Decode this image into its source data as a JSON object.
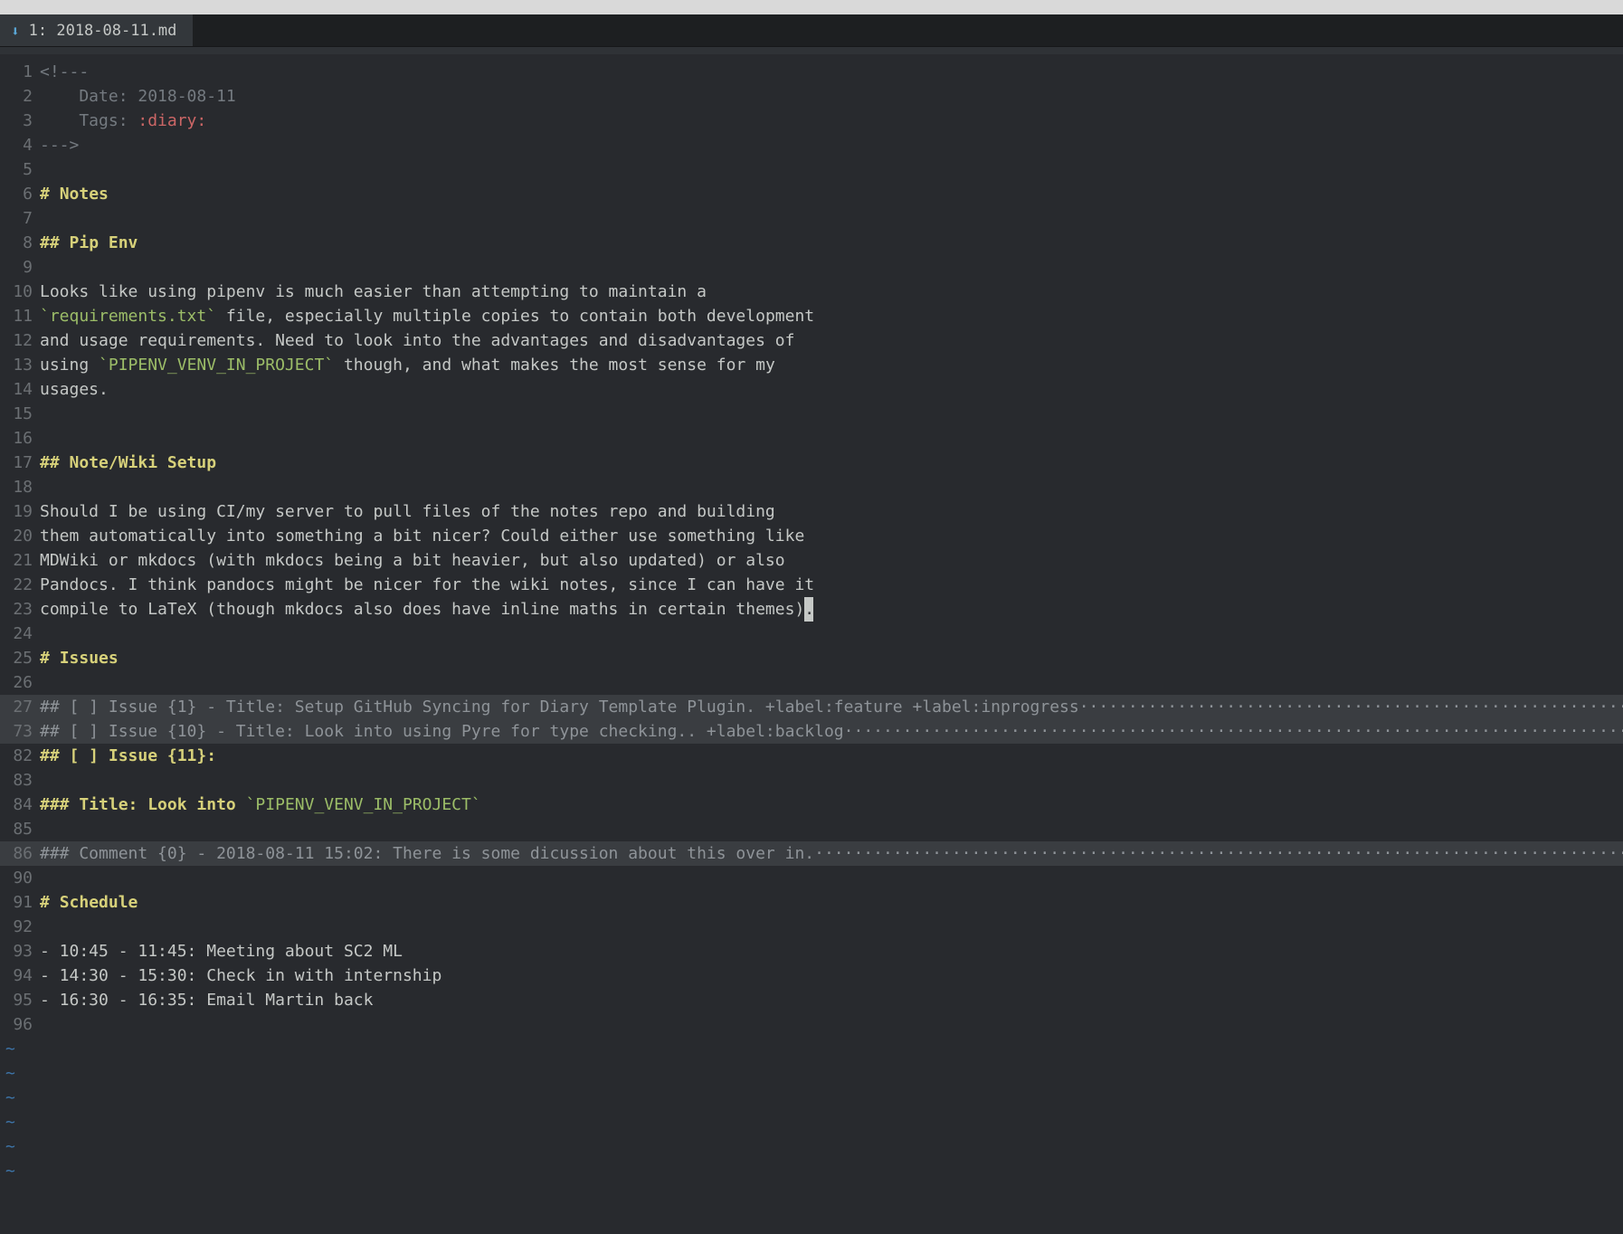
{
  "tab": {
    "icon_glyph": "⬇",
    "label": "1: 2018-08-11.md"
  },
  "dots_long": "·················································································································",
  "lines": [
    {
      "num": "1",
      "segments": [
        {
          "cls": "comment",
          "text": "<!---"
        }
      ]
    },
    {
      "num": "2",
      "segments": [
        {
          "cls": "comment",
          "text": "    Date: 2018-08-11"
        }
      ]
    },
    {
      "num": "3",
      "segments": [
        {
          "cls": "comment",
          "text": "    Tags: "
        },
        {
          "cls": "red",
          "text": ":diary:"
        }
      ]
    },
    {
      "num": "4",
      "segments": [
        {
          "cls": "comment",
          "text": "--->"
        }
      ]
    },
    {
      "num": "5",
      "segments": []
    },
    {
      "num": "6",
      "segments": [
        {
          "cls": "yellow",
          "text": "# "
        },
        {
          "cls": "yellow",
          "text": "Notes"
        }
      ]
    },
    {
      "num": "7",
      "segments": []
    },
    {
      "num": "8",
      "segments": [
        {
          "cls": "yellow",
          "text": "## "
        },
        {
          "cls": "yellow",
          "text": "Pip Env"
        }
      ]
    },
    {
      "num": "9",
      "segments": []
    },
    {
      "num": "10",
      "segments": [
        {
          "cls": "plain",
          "text": "Looks like using pipenv is much easier than attempting to maintain a"
        }
      ]
    },
    {
      "num": "11",
      "segments": [
        {
          "cls": "green",
          "text": "`requirements.txt`"
        },
        {
          "cls": "plain",
          "text": " file, especially multiple copies to contain both development"
        }
      ]
    },
    {
      "num": "12",
      "segments": [
        {
          "cls": "plain",
          "text": "and usage requirements. Need to look into the advantages and disadvantages of"
        }
      ]
    },
    {
      "num": "13",
      "segments": [
        {
          "cls": "plain",
          "text": "using "
        },
        {
          "cls": "green",
          "text": "`PIPENV_VENV_IN_PROJECT`"
        },
        {
          "cls": "plain",
          "text": " though, and what makes the most sense for my"
        }
      ]
    },
    {
      "num": "14",
      "segments": [
        {
          "cls": "plain",
          "text": "usages."
        }
      ]
    },
    {
      "num": "15",
      "segments": []
    },
    {
      "num": "16",
      "segments": []
    },
    {
      "num": "17",
      "segments": [
        {
          "cls": "yellow",
          "text": "## "
        },
        {
          "cls": "yellow",
          "text": "Note/Wiki Setup"
        }
      ]
    },
    {
      "num": "18",
      "segments": []
    },
    {
      "num": "19",
      "segments": [
        {
          "cls": "plain",
          "text": "Should I be using CI/my server to pull files of the notes repo and building"
        }
      ]
    },
    {
      "num": "20",
      "segments": [
        {
          "cls": "plain",
          "text": "them automatically into something a bit nicer? Could either use something like"
        }
      ]
    },
    {
      "num": "21",
      "segments": [
        {
          "cls": "plain",
          "text": "MDWiki or mkdocs (with mkdocs being a bit heavier, but also updated) or also"
        }
      ]
    },
    {
      "num": "22",
      "segments": [
        {
          "cls": "plain",
          "text": "Pandocs. I think pandocs might be nicer for the wiki notes, since I can have it"
        }
      ]
    },
    {
      "num": "23",
      "segments": [
        {
          "cls": "plain",
          "text": "compile to LaTeX (though mkdocs also does have inline maths in certain themes)"
        },
        {
          "cls": "cursor",
          "text": "."
        }
      ]
    },
    {
      "num": "24",
      "segments": []
    },
    {
      "num": "25",
      "segments": [
        {
          "cls": "yellow",
          "text": "# "
        },
        {
          "cls": "yellow",
          "text": "Issues"
        }
      ]
    },
    {
      "num": "26",
      "segments": []
    },
    {
      "num": "27",
      "fold": true,
      "segments": [
        {
          "cls": "foldtext",
          "text": "## [ ] Issue {1} - Title: Setup GitHub Syncing for Diary Template Plugin. +label:feature +label:inprogress"
        },
        {
          "cls": "dots",
          "bind": "dots_long"
        }
      ]
    },
    {
      "num": "73",
      "fold": true,
      "segments": [
        {
          "cls": "foldtext",
          "text": "## [ ] Issue {10} - Title: Look into using Pyre for type checking.. +label:backlog"
        },
        {
          "cls": "dots",
          "bind": "dots_long"
        }
      ]
    },
    {
      "num": "82",
      "segments": [
        {
          "cls": "yellow",
          "text": "## [ ] Issue {11}:"
        }
      ]
    },
    {
      "num": "83",
      "segments": []
    },
    {
      "num": "84",
      "segments": [
        {
          "cls": "yellow",
          "text": "### "
        },
        {
          "cls": "yellow",
          "text": "Title: Look into "
        },
        {
          "cls": "green",
          "text": "`PIPENV_VENV_IN_PROJECT`"
        }
      ]
    },
    {
      "num": "85",
      "segments": []
    },
    {
      "num": "86",
      "fold": true,
      "segments": [
        {
          "cls": "foldtext",
          "text": "### Comment {0} - 2018-08-11 15:02: There is some dicussion about this over in."
        },
        {
          "cls": "dots",
          "bind": "dots_long"
        }
      ]
    },
    {
      "num": "90",
      "segments": []
    },
    {
      "num": "91",
      "segments": [
        {
          "cls": "yellow",
          "text": "# "
        },
        {
          "cls": "yellow",
          "text": "Schedule"
        }
      ]
    },
    {
      "num": "92",
      "segments": []
    },
    {
      "num": "93",
      "segments": [
        {
          "cls": "plain",
          "text": "- 10:45 - 11:45: Meeting about SC2 ML"
        }
      ]
    },
    {
      "num": "94",
      "segments": [
        {
          "cls": "plain",
          "text": "- 14:30 - 15:30: Check in with internship"
        }
      ]
    },
    {
      "num": "95",
      "segments": [
        {
          "cls": "plain",
          "text": "- 16:30 - 16:35: Email Martin back"
        }
      ]
    },
    {
      "num": "96",
      "segments": []
    }
  ],
  "tilde_count": 6,
  "tilde_glyph": "~"
}
